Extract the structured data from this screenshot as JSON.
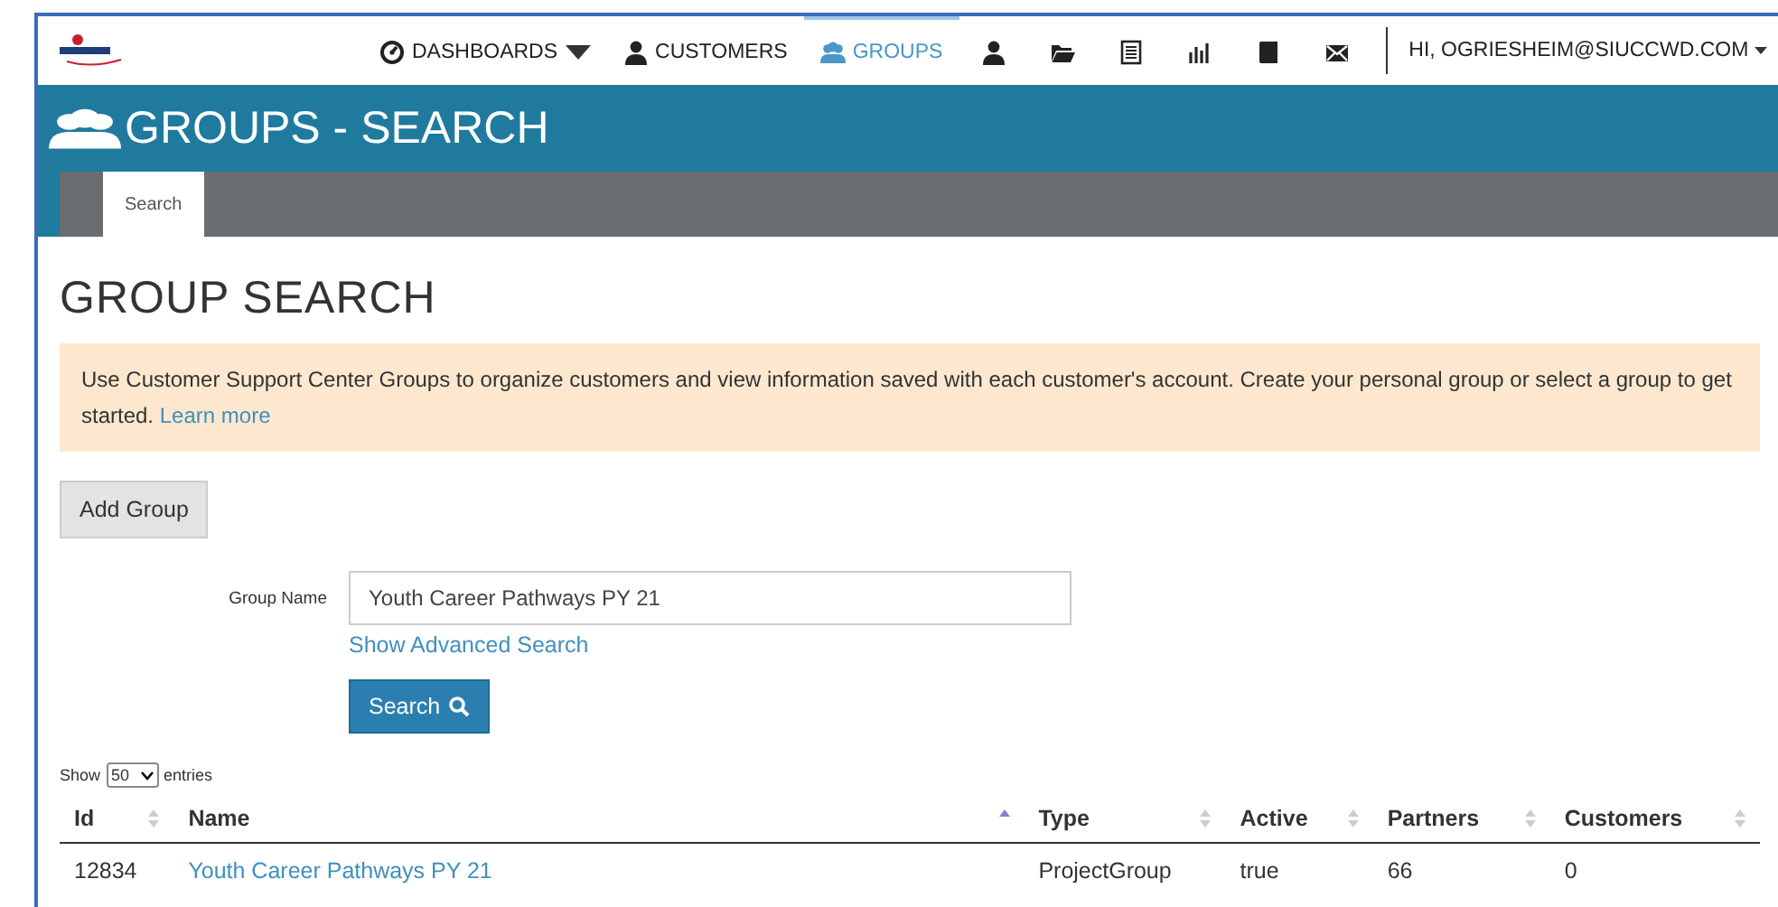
{
  "nav": {
    "items": [
      {
        "kind": "text",
        "label": "DASHBOARDS",
        "dropdown": true,
        "selected": false
      },
      {
        "kind": "text",
        "label": "CUSTOMERS",
        "dropdown": false,
        "selected": false
      },
      {
        "kind": "text",
        "label": "GROUPS",
        "dropdown": false,
        "selected": true
      },
      {
        "kind": "icon",
        "selected": false
      },
      {
        "kind": "icon",
        "selected": false
      },
      {
        "kind": "icon",
        "selected": false
      },
      {
        "kind": "icon",
        "selected": false
      },
      {
        "kind": "icon",
        "selected": false
      },
      {
        "kind": "icon",
        "selected": false
      }
    ],
    "user": "HI, OGRIESHEIM@SIUCCWD.COM"
  },
  "header": {
    "title": "GROUPS - SEARCH"
  },
  "tabs": [
    {
      "label": "Search",
      "selected": true
    }
  ],
  "page_title": "GROUP SEARCH",
  "notice": {
    "text": "Use Customer Support Center Groups to organize customers and view information saved with each customer's account. Create your personal group or select a group to get started.",
    "link": "Learn more"
  },
  "add_button": "Add Group",
  "form": {
    "label": "Group Name",
    "value": "Youth Career Pathways PY 21",
    "advanced_link": "Show Advanced Search",
    "search_button": "Search"
  },
  "table": {
    "show_label": "Show",
    "page_size": "50",
    "entries_label": "entries",
    "columns": [
      {
        "label": "Id",
        "selected": false
      },
      {
        "label": "Name",
        "selected": true
      },
      {
        "label": "Type",
        "selected": false
      },
      {
        "label": "Active",
        "selected": false
      },
      {
        "label": "Partners",
        "selected": false
      },
      {
        "label": "Customers",
        "selected": false
      }
    ],
    "rows": [
      {
        "cells": [
          "12834",
          "Youth Career Pathways PY 21",
          "ProjectGroup",
          "true",
          "66",
          "0"
        ]
      }
    ]
  }
}
